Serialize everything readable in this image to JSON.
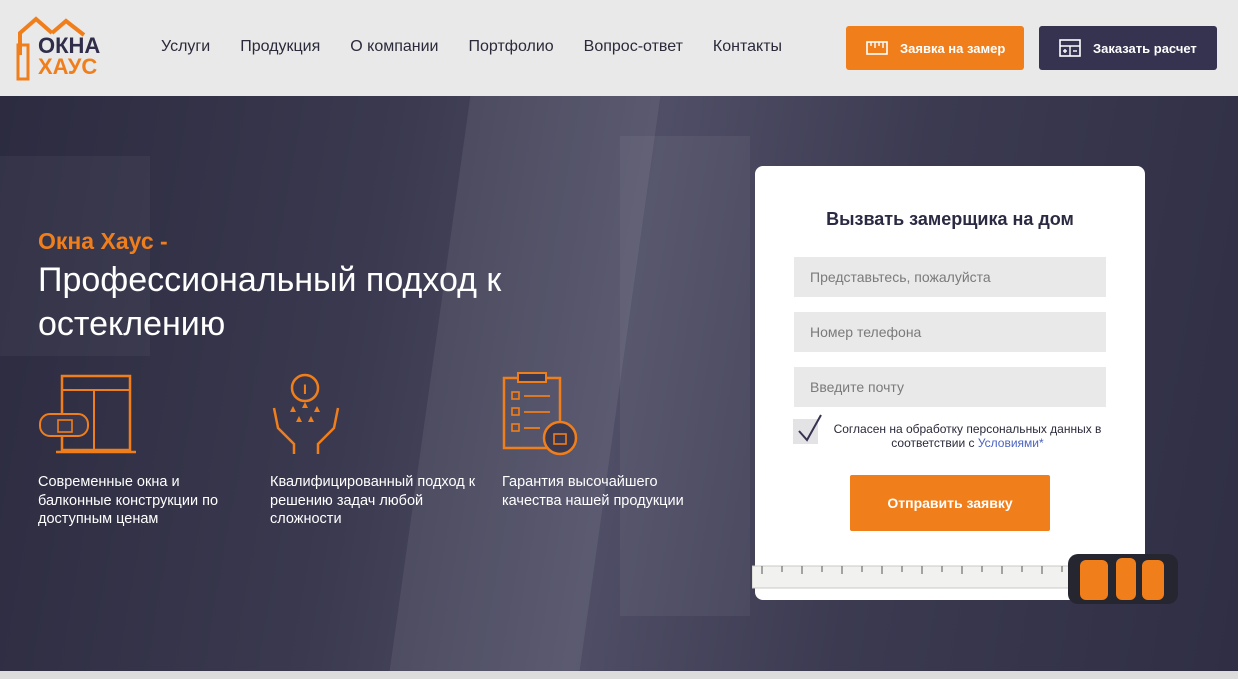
{
  "logo": {
    "line1": "ОКНА",
    "line2": "ХАУС",
    "icon": "house-roof-icon"
  },
  "nav": {
    "items": [
      "Услуги",
      "Продукция",
      "О компании",
      "Портфолио",
      "Вопрос-ответ",
      "Контакты"
    ]
  },
  "header_buttons": {
    "measure": {
      "label": "Заявка на замер",
      "icon": "tape-measure-icon"
    },
    "calc": {
      "label": "Заказать расчет",
      "icon": "calculator-icon"
    }
  },
  "hero": {
    "brand": "Окна Хаус -",
    "headline": "Профессиональный подход к остеклению",
    "features": [
      {
        "icon": "window-like-icon",
        "text": "Современные окна и балконные конструкции по доступным ценам"
      },
      {
        "icon": "award-hands-icon",
        "text": "Квалифицированный подход к решению задач любой сложности"
      },
      {
        "icon": "checklist-like-icon",
        "text": "Гарантия высочайшего качества нашей продукции"
      }
    ]
  },
  "form": {
    "title": "Вызвать замерщика на дом",
    "name_placeholder": "Представьтесь, пожалуйста",
    "phone_placeholder": "Номер телефона",
    "email_placeholder": "Введите почту",
    "consent_text": "Согласен на обработку персональных данных в соответствии с",
    "consent_link": "Условиями*",
    "checked": true,
    "submit_label": "Отправить заявку"
  },
  "colors": {
    "accent": "#f07e1b",
    "dark": "#35334f",
    "hero_bg": "#3a394f"
  }
}
